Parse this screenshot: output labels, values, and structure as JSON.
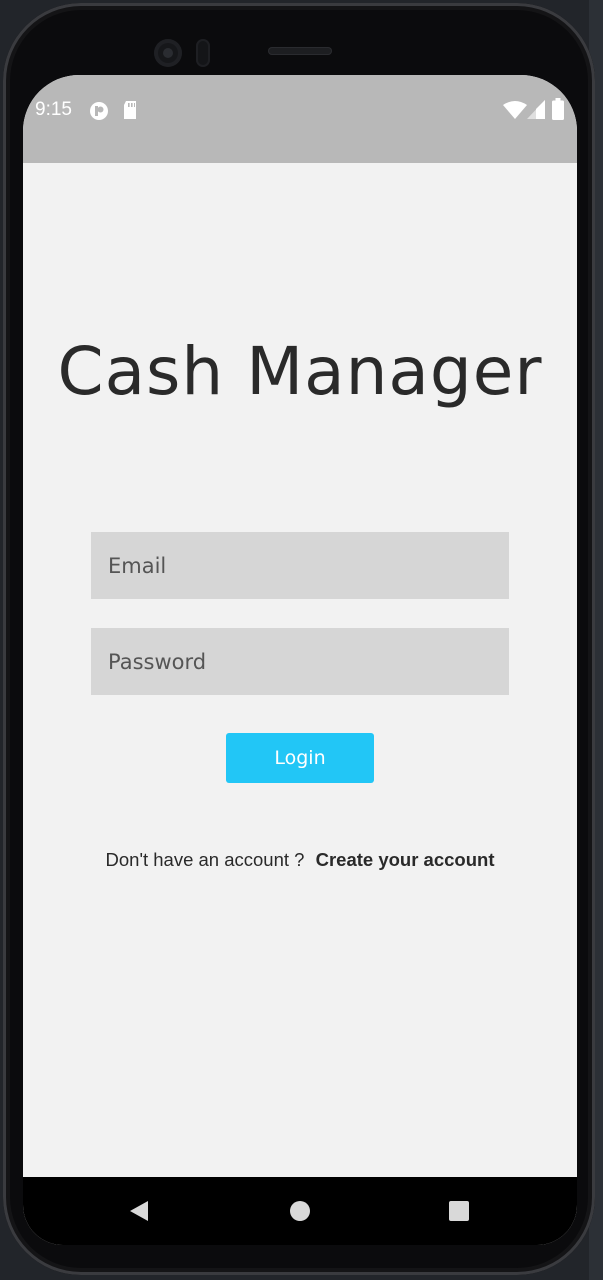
{
  "status_bar": {
    "time": "9:15",
    "icons": [
      "app-notification-icon",
      "sd-card-icon",
      "wifi-icon",
      "cell-signal-icon",
      "battery-icon"
    ]
  },
  "login": {
    "title": "Cash Manager",
    "email_placeholder": "Email",
    "password_placeholder": "Password",
    "login_label": "Login",
    "signup_prompt": "Don't have an account ?",
    "signup_link": "Create your account"
  },
  "nav_bar": {
    "buttons": [
      "back-icon",
      "home-icon",
      "recents-icon"
    ]
  },
  "colors": {
    "accent": "#22c6f6",
    "background": "#f2f2f2",
    "field": "#d6d6d6",
    "status_bar": "#b8b8b8"
  }
}
